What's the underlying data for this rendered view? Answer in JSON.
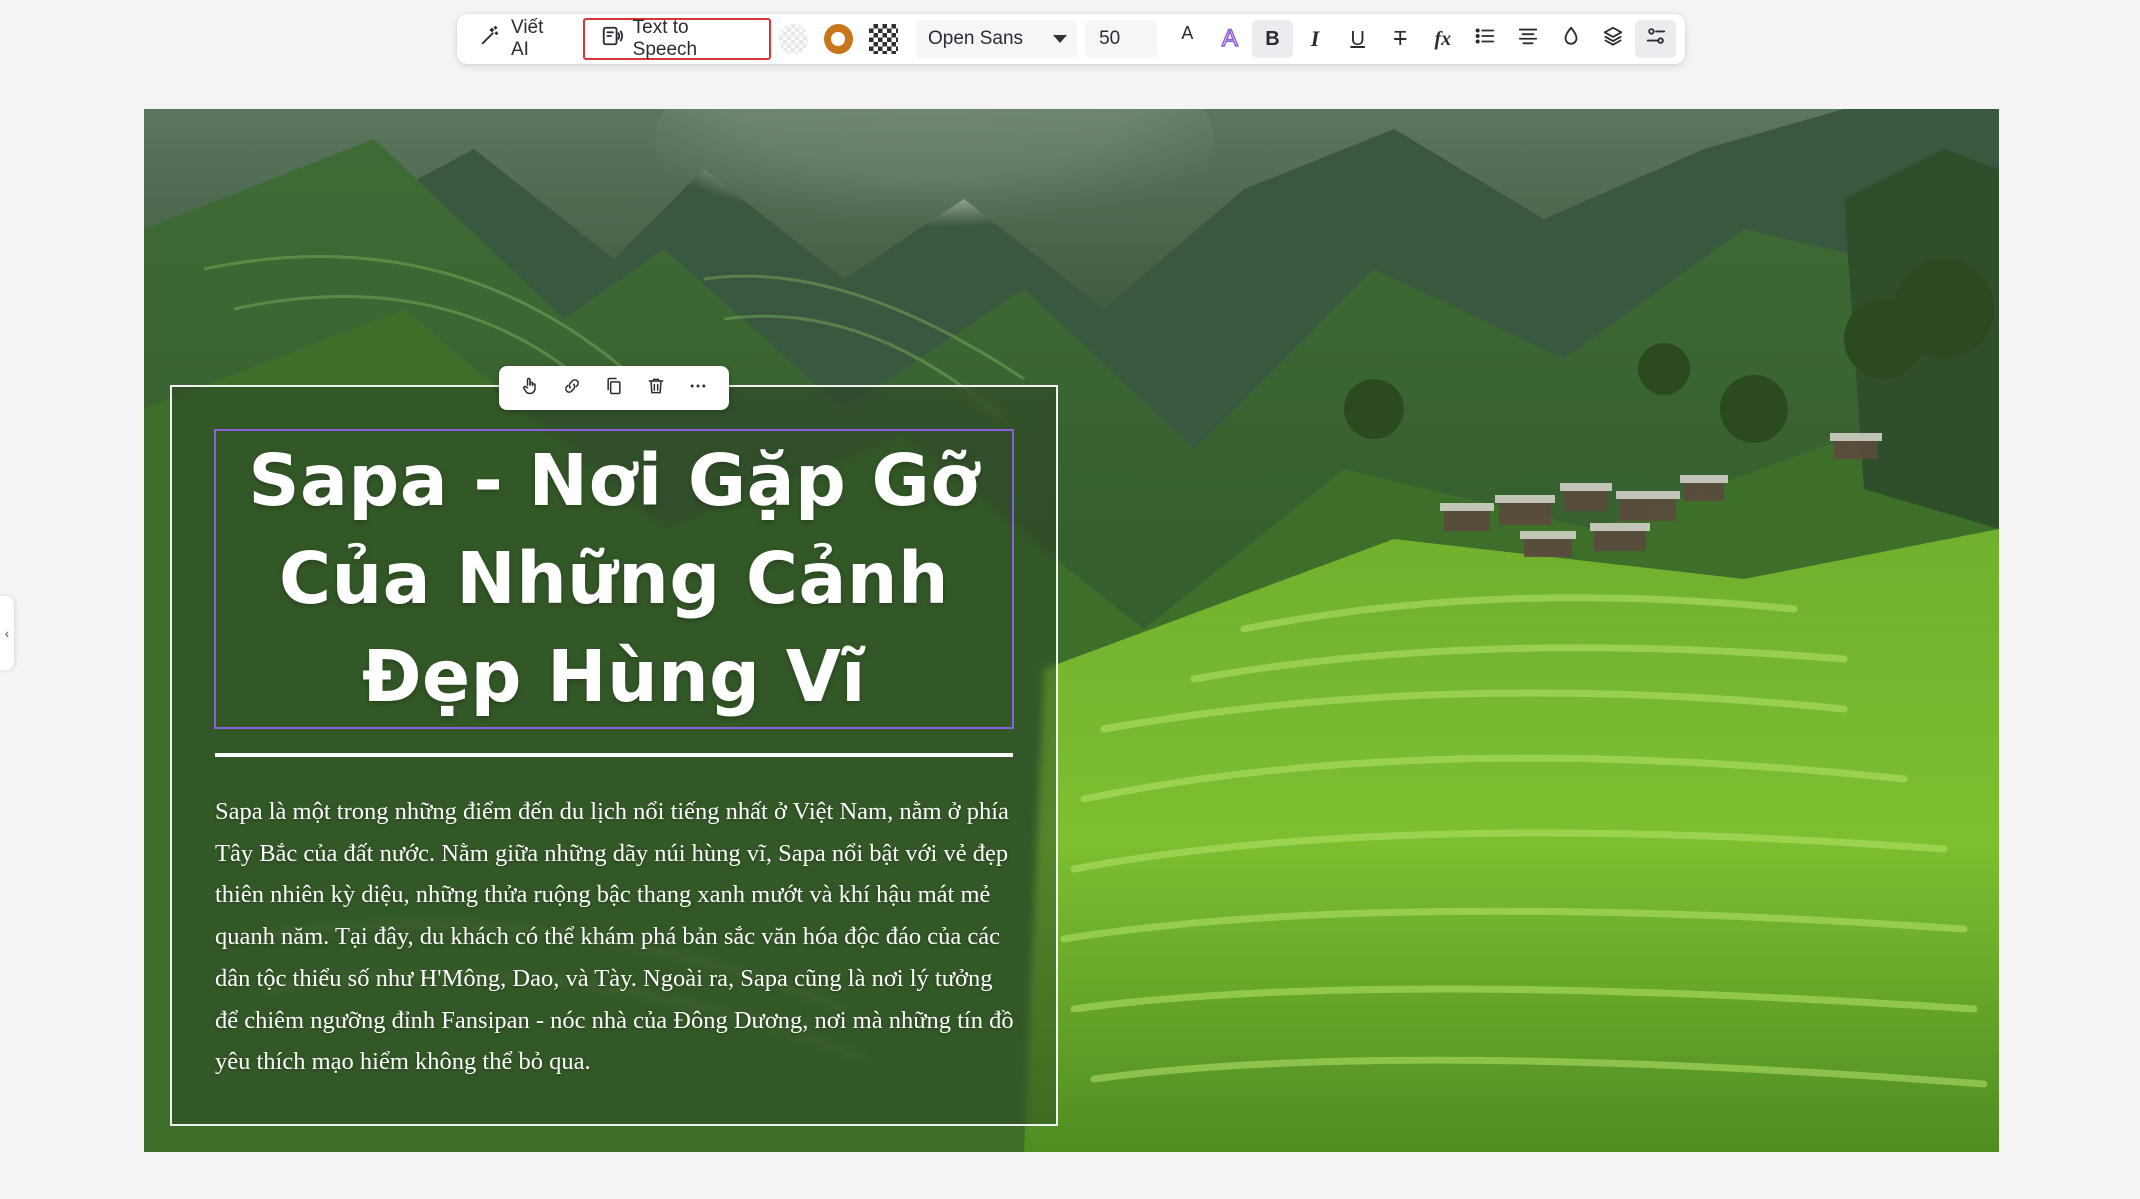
{
  "toolbar": {
    "ai_write_label": "Viết AI",
    "tts_label": "Text to Speech",
    "font_family": "Open Sans",
    "font_size": "50",
    "text_color_glyph": "A",
    "gradient_glyph": "A",
    "bold_glyph": "B",
    "italic_glyph": "I",
    "underline_glyph": "U",
    "strike_glyph": "T",
    "clear_format_glyph": "fx",
    "accent_ring_color": "#c7761c",
    "tts_highlight_color": "#d93535"
  },
  "side_handle": {
    "glyph": "‹"
  },
  "slide": {
    "title": "Sapa - Nơi Gặp Gỡ Của Những Cảnh Đẹp Hùng Vĩ",
    "body": "Sapa là một trong những điểm đến du lịch nổi tiếng nhất ở Việt Nam, nằm ở phía Tây Bắc của đất nước. Nằm giữa những dãy núi hùng vĩ, Sapa nổi bật với vẻ đẹp thiên nhiên kỳ diệu, những thửa ruộng bậc thang xanh mướt và khí hậu mát mẻ quanh năm. Tại đây, du khách có thể khám phá bản sắc văn hóa độc đáo của các dân tộc thiểu số như H'Mông, Dao, và Tày. Ngoài ra, Sapa cũng là nơi lý tưởng để chiêm ngưỡng đỉnh Fansipan - nóc nhà của Đông Dương, nơi mà những tín đồ yêu thích mạo hiểm không thể bỏ qua.",
    "selection_color": "#8a5fe0"
  }
}
